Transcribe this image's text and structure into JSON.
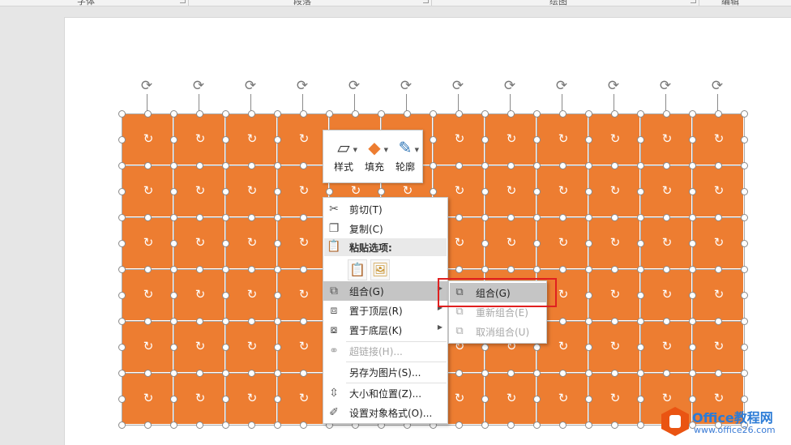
{
  "ribbon": {
    "groups": [
      "字体",
      "段落",
      "绘图",
      "编辑"
    ]
  },
  "mini_toolbar": {
    "buttons": [
      {
        "label": "样式",
        "icon": "shape-style-icon"
      },
      {
        "label": "填充",
        "icon": "paint-bucket-icon"
      },
      {
        "label": "轮廓",
        "icon": "pen-outline-icon"
      }
    ]
  },
  "context_menu": {
    "cut": "剪切(T)",
    "copy": "复制(C)",
    "paste_header": "粘贴选项:",
    "group": "组合(G)",
    "bring_front": "置于顶层(R)",
    "send_back": "置于底层(K)",
    "hyperlink": "超链接(H)...",
    "save_as_picture": "另存为图片(S)...",
    "size_position": "大小和位置(Z)...",
    "format_object": "设置对象格式(O)..."
  },
  "submenu": {
    "group": "组合(G)",
    "regroup": "重新组合(E)",
    "ungroup": "取消组合(U)"
  },
  "watermark": {
    "title": "Office教程网",
    "url": "www.office26.com"
  },
  "colors": {
    "shape_fill": "#ed7d31",
    "highlight_box": "#e02020",
    "menu_hover": "#c5c5c5"
  }
}
